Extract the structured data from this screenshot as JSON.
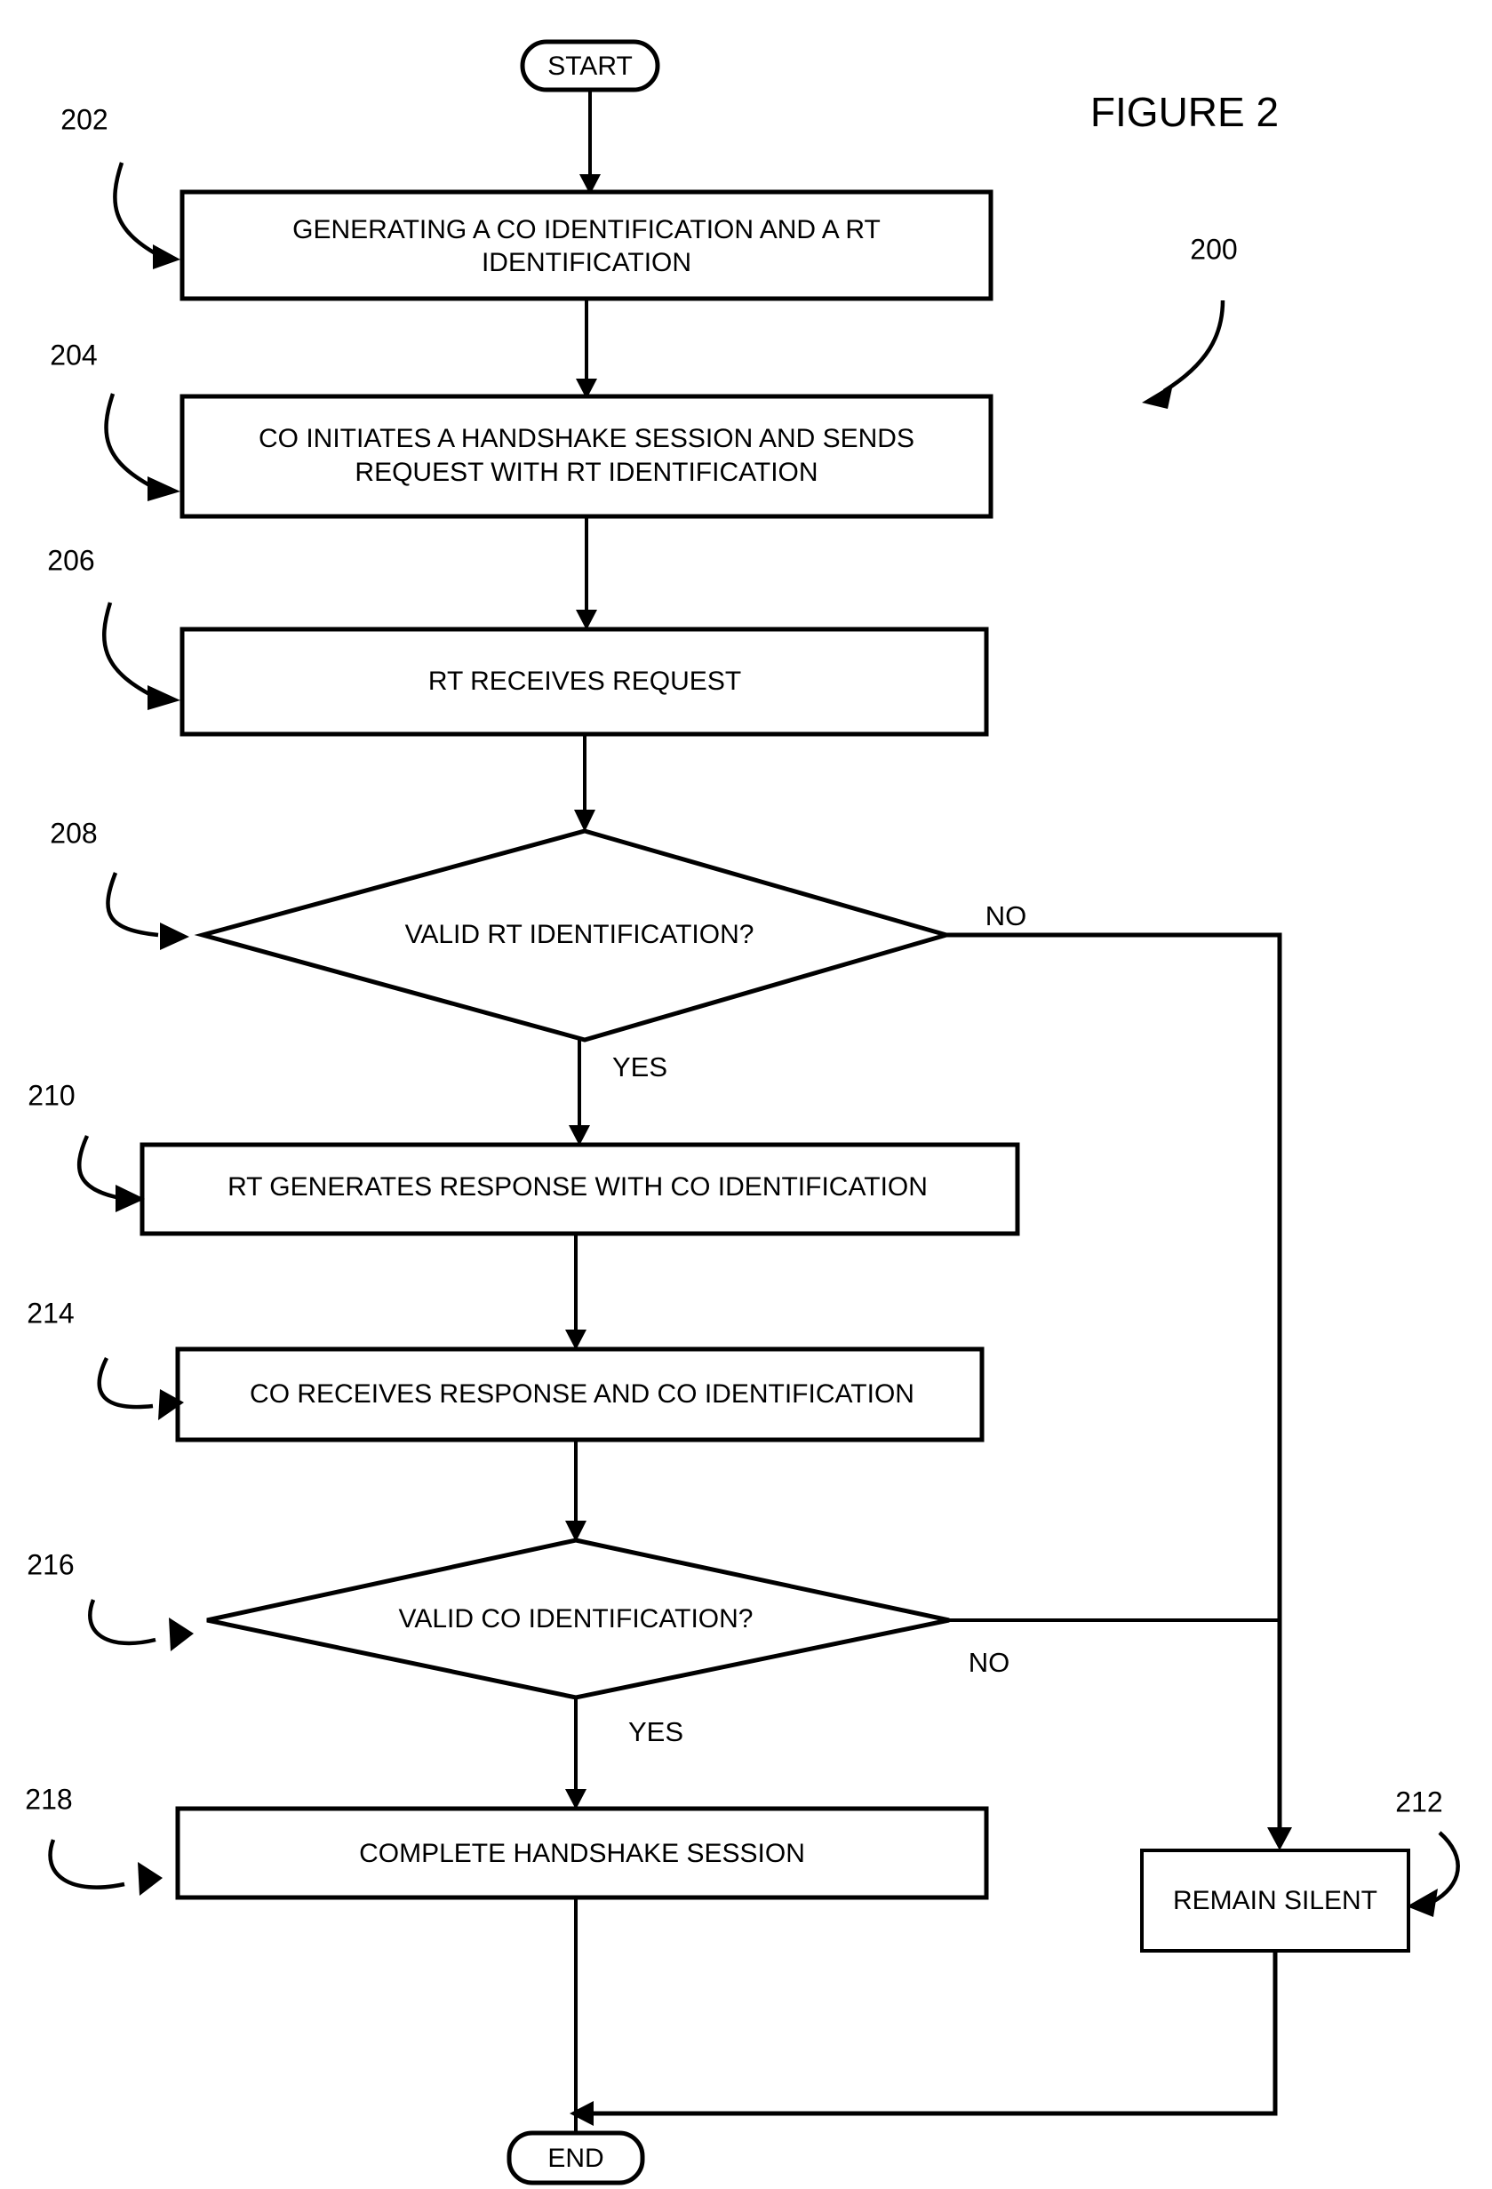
{
  "figure": {
    "title": "FIGURE 2",
    "diagram_reference": "200"
  },
  "terminators": {
    "start": "START",
    "end": "END"
  },
  "nodes": [
    {
      "ref": "202",
      "type": "process",
      "line1": "GENERATING A CO IDENTIFICATION AND A RT",
      "line2": "IDENTIFICATION"
    },
    {
      "ref": "204",
      "type": "process",
      "line1": "CO INITIATES A HANDSHAKE SESSION AND SENDS",
      "line2": "REQUEST WITH RT IDENTIFICATION"
    },
    {
      "ref": "206",
      "type": "process",
      "line1": "RT RECEIVES REQUEST",
      "line2": ""
    },
    {
      "ref": "208",
      "type": "decision",
      "line1": "VALID RT IDENTIFICATION?",
      "line2": ""
    },
    {
      "ref": "210",
      "type": "process",
      "line1": "RT GENERATES RESPONSE WITH CO IDENTIFICATION",
      "line2": ""
    },
    {
      "ref": "214",
      "type": "process",
      "line1": "CO RECEIVES RESPONSE AND CO IDENTIFICATION",
      "line2": ""
    },
    {
      "ref": "216",
      "type": "decision",
      "line1": "VALID CO IDENTIFICATION?",
      "line2": ""
    },
    {
      "ref": "218",
      "type": "process",
      "line1": "COMPLETE HANDSHAKE SESSION",
      "line2": ""
    },
    {
      "ref": "212",
      "type": "process",
      "line1": "REMAIN SILENT",
      "line2": ""
    }
  ],
  "branch_labels": {
    "decision_208_no": "NO",
    "decision_208_yes": "YES",
    "decision_216_no": "NO",
    "decision_216_yes": "YES"
  },
  "colors": {
    "ink": "#000000",
    "paper": "#ffffff"
  }
}
